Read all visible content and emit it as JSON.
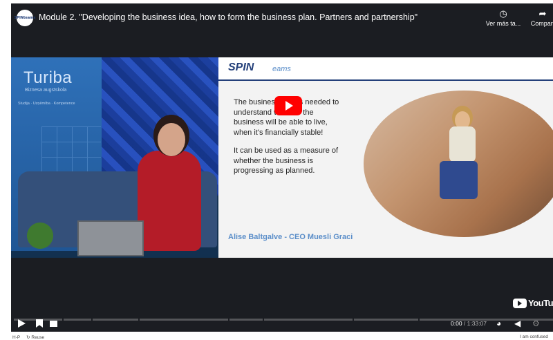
{
  "header": {
    "channel_logo_text": "SPINteams",
    "title": "Module 2. \"Developing the business idea, how to form the business plan. Partners and partnership\"",
    "watch_later_label": "Ver más ta...",
    "share_label": "Compart"
  },
  "studio": {
    "banner_logo": "Turiba",
    "banner_subtitle": "Biznesa augstskola",
    "banner_line": "Studija · Uzņēmība · Kompetence"
  },
  "slide": {
    "logo": "SPIN",
    "logo_suffix": "eams",
    "paragraph1": "The business plan is needed to understand whether the business will be able to live, when it's financially stable!",
    "paragraph2": "It can be used as a measure of whether the business is progressing as planned.",
    "caption": "Alise Baltgalve - CEO Muesli Graci"
  },
  "player": {
    "brand": "YouTube",
    "current_time": "0:00",
    "duration": "1:33:07",
    "progress": 0
  },
  "footer": {
    "left_label": "H-P",
    "reuse_label": "Reuse",
    "right_label": "I am confused"
  },
  "colors": {
    "accent": "#ff0000",
    "player_bg": "#1b1d22",
    "slide_brand": "#24407a",
    "caption": "#5b8ec9"
  }
}
